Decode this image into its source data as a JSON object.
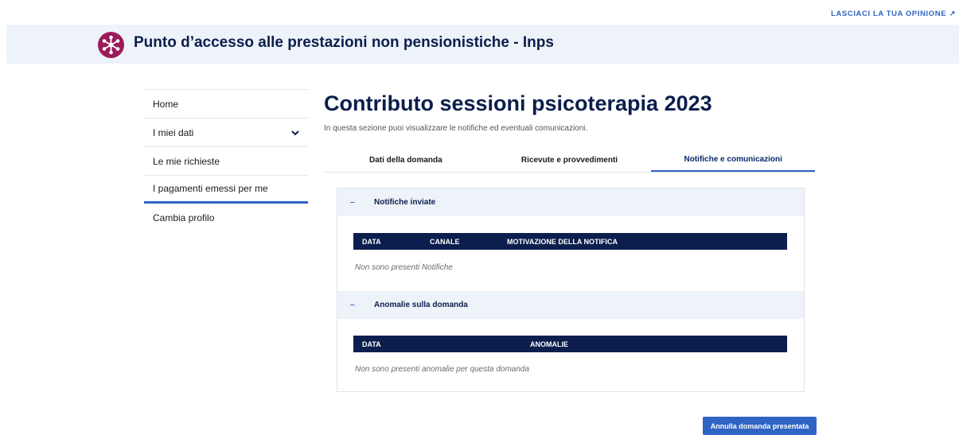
{
  "header": {
    "feedback_link": "LASCIACI LA TUA OPINIONE",
    "feedback_icon": "external-link-icon",
    "app_title": "Punto d’accesso alle prestazioni non pensionistiche - Inps",
    "logo_icon": "network-nodes-icon",
    "logo_color": "#9b1b5a"
  },
  "sidebar": {
    "items": [
      {
        "label": "Home"
      },
      {
        "label": "I miei dati",
        "icon": "chevron-down-icon"
      },
      {
        "label": "Le mie richieste"
      },
      {
        "label": "I pagamenti emessi per me"
      },
      {
        "label": "Cambia profilo"
      }
    ]
  },
  "main": {
    "title": "Contributo sessioni psicoterapia 2023",
    "intro": "In questa sezione puoi visualizzare le notifiche ed eventuali comunicazioni.",
    "tabs": [
      {
        "label": "Dati della domanda"
      },
      {
        "label": "Ricevute e provvedimenti"
      },
      {
        "label": "Notifiche e comunicazioni",
        "active": true
      }
    ],
    "sections": [
      {
        "toggle": "–",
        "title": "Notifiche inviate",
        "columns": [
          "DATA",
          "CANALE",
          "MOTIVAZIONE DELLA NOTIFICA"
        ],
        "empty": "Non sono presenti Notifiche"
      },
      {
        "toggle": "–",
        "title": "Anomalie sulla domanda",
        "columns": [
          "DATA",
          "ANOMALIE"
        ],
        "empty": "Non sono presenti anomalie per questa domanda"
      }
    ],
    "cancel_button": "Annulla domanda presentata"
  },
  "colors": {
    "navy": "#0b1e4d",
    "accent": "#2f64c4",
    "banner_bg": "#eef2f9"
  }
}
